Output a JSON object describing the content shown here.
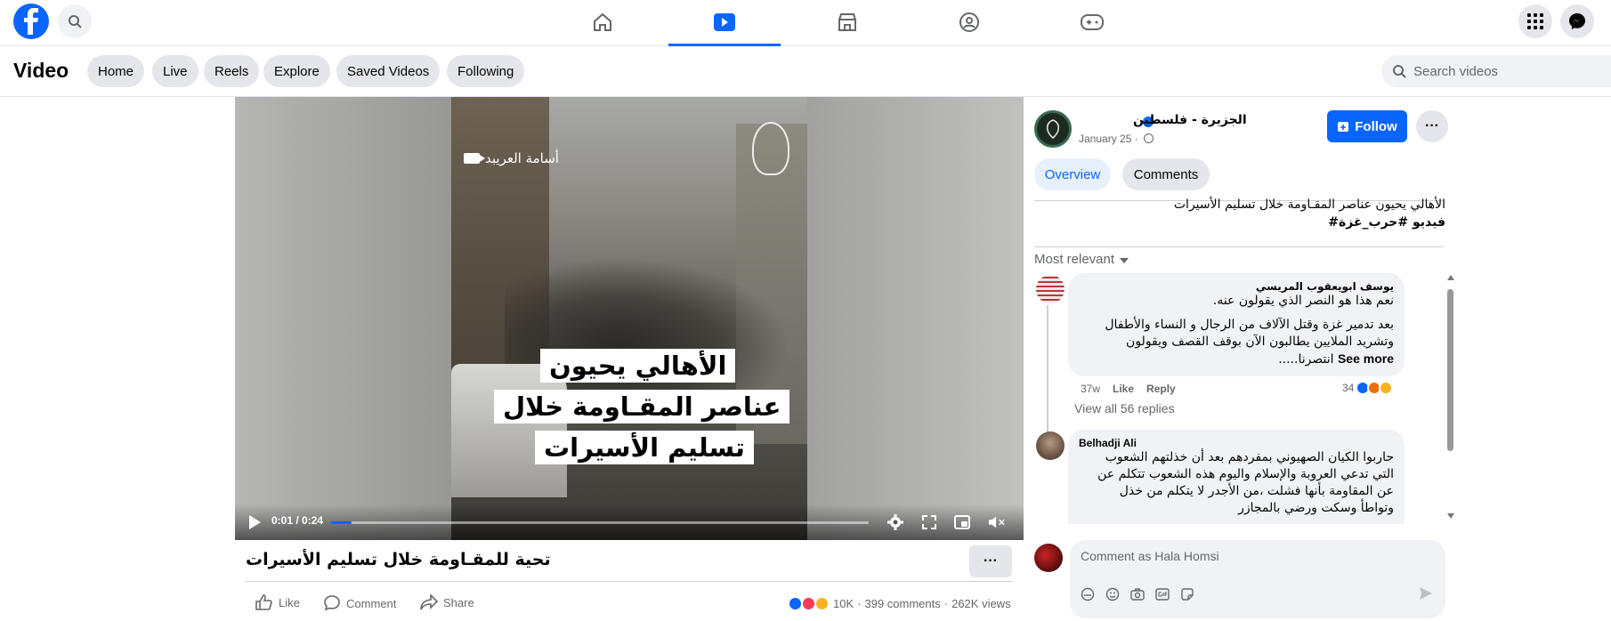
{
  "topbar": {
    "icons": [
      "facebook-logo",
      "search-icon",
      "home-icon",
      "video-icon",
      "marketplace-icon",
      "groups-icon",
      "gaming-icon",
      "menu-grid-icon",
      "messenger-icon"
    ]
  },
  "subnav": {
    "title": "Video",
    "pills": [
      "Home",
      "Live",
      "Reels",
      "Explore",
      "Saved Videos",
      "Following"
    ],
    "search_placeholder": "Search videos"
  },
  "player": {
    "camera_credit": "أسامة العريبد",
    "overlay_lines": [
      "الأهالي يحيون",
      "عناصر المقـاومة خلال",
      "تسليم الأسيرات"
    ],
    "time": "0:01 / 0:24",
    "progress": 0.04
  },
  "video_caption": "تحية للمقـاومة خلال تسليم الأسيرات",
  "actions": {
    "like": "Like",
    "comment": "Comment",
    "share": "Share",
    "reactions_count": "10K",
    "comments_count": "399 comments",
    "views": "262K views"
  },
  "page": {
    "name": "الجزيرة - فلسطين",
    "date": "January 25 ·",
    "follow_label": "Follow",
    "tabs": [
      "Overview",
      "Comments"
    ],
    "description_line1": "الأهالي يحيون عناصر المقـاومة خلال تسليم الأسيرات",
    "description_line2": "#فيديو #حرب_غزة",
    "sort_label": "Most relevant"
  },
  "comments": [
    {
      "author": "يوسف ابويعقوب المريسي",
      "text1": "نعم هذا هو النصر الذي يقولون عنه.",
      "text2": "بعد تدمير غزة وقتل الآلاف من الرجال و النساء والأطفال",
      "text3": "وتشريد الملايين يطالبون الآن بوقف القصف ويقولون",
      "text4": "انتصرنا.....",
      "see_more": "See more",
      "age": "37w",
      "like": "Like",
      "reply": "Reply",
      "reaction_count": "34",
      "view_replies": "View all 56 replies"
    },
    {
      "author": "Belhadji Ali",
      "text1": "حاربوا الكيان الصهيوني بمفردهم بعد أن خذلتهم الشعوب",
      "text2": "التي تدعي العروبة والإسلام واليوم هذه الشعوب تتكلم عن",
      "text3": "عن المقاومة بأنها فشلت ،من الأجدر لا يتكلم من خذل",
      "text4": "وتواطأ وسكت ورضي بالمجازر"
    }
  ],
  "composer": {
    "placeholder": "Comment as Hala Homsi"
  },
  "colors": {
    "accent": "#0866ff",
    "pill_bg": "#e4e6eb",
    "muted": "#65676b"
  }
}
